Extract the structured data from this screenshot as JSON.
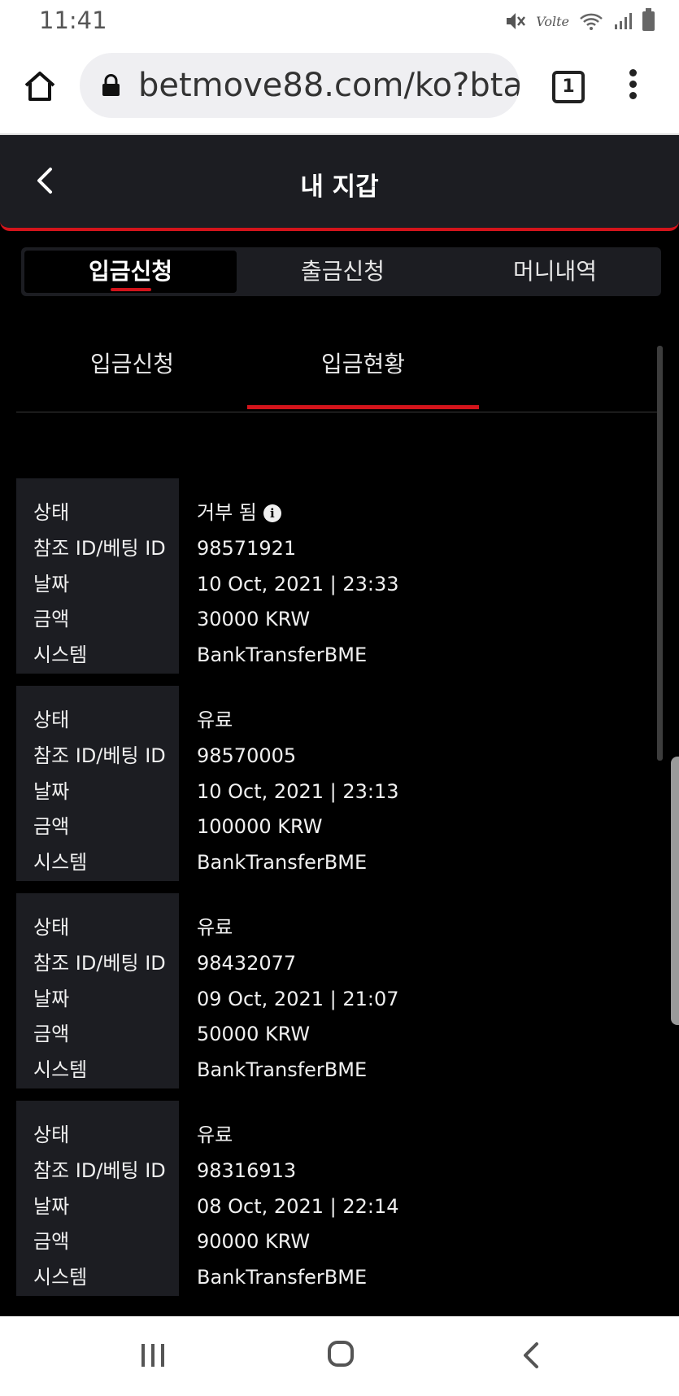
{
  "status_bar": {
    "time": "11:41",
    "volte_label": "Volte",
    "icons": [
      "mute-icon",
      "volte-icon",
      "wifi-icon",
      "signal-icon",
      "battery-icon"
    ]
  },
  "browser": {
    "url": "betmove88.com/ko?bta",
    "tab_count": "1",
    "icons": [
      "home-icon",
      "lock-icon",
      "tabs-icon",
      "menu-icon"
    ]
  },
  "header": {
    "title": "내 지갑",
    "back_icon": "chevron-left-icon",
    "accent": "#d3141b"
  },
  "main_tabs": [
    {
      "label": "입금신청",
      "active": true
    },
    {
      "label": "출금신청",
      "active": false
    },
    {
      "label": "머니내역",
      "active": false
    }
  ],
  "sub_tabs": [
    {
      "label": "입금신청",
      "active": false
    },
    {
      "label": "입금현황",
      "active": true
    }
  ],
  "record_labels": {
    "status": "상태",
    "ref_id": "참조 ID/베팅 ID",
    "date": "날짜",
    "amount": "금액",
    "system": "시스템"
  },
  "records": [
    {
      "status": "거부 됨",
      "ref_id": "98571921",
      "date": "10 Oct, 2021 | 23:33",
      "amount": "30000 KRW",
      "system": "BankTransferBME"
    },
    {
      "status": "유료",
      "ref_id": "98570005",
      "date": "10 Oct, 2021 | 23:13",
      "amount": "100000 KRW",
      "system": "BankTransferBME"
    },
    {
      "status": "유료",
      "ref_id": "98432077",
      "date": "09 Oct, 2021 | 21:07",
      "amount": "50000 KRW",
      "system": "BankTransferBME"
    },
    {
      "status": "유료",
      "ref_id": "98316913",
      "date": "08 Oct, 2021 | 22:14",
      "amount": "90000 KRW",
      "system": "BankTransferBME"
    }
  ],
  "info_glyph": "i",
  "nav_bar": {
    "icons": [
      "recents-icon",
      "home-circle-icon",
      "back-icon"
    ]
  }
}
